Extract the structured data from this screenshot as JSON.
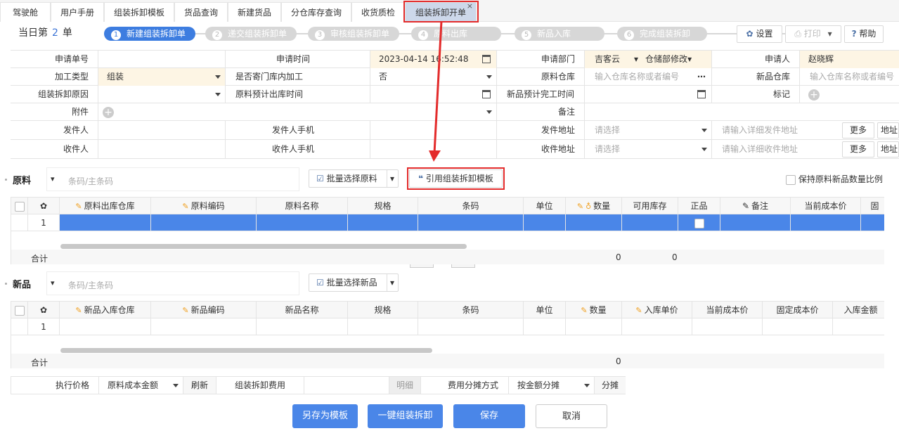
{
  "tabs": [
    "驾驶舱",
    "用户手册",
    "组装拆卸模板",
    "货品查询",
    "新建货品",
    "分仓库存查询",
    "收货质检",
    "组装拆卸开单"
  ],
  "tab_close": "×",
  "daycount": {
    "prefix": "当日第",
    "count": "2",
    "suffix": "单"
  },
  "steps": [
    {
      "n": "1",
      "label": "新建组装拆卸单"
    },
    {
      "n": "2",
      "label": "递交组装拆卸单"
    },
    {
      "n": "3",
      "label": "审核组装拆卸单"
    },
    {
      "n": "4",
      "label": "原料出库"
    },
    {
      "n": "5",
      "label": "新品入库"
    },
    {
      "n": "6",
      "label": "完成组装拆卸"
    }
  ],
  "toolbar": {
    "settings": "设置",
    "print": "打印",
    "help": "帮助"
  },
  "form": {
    "order_no_label": "申请单号",
    "order_no": "",
    "apply_time_label": "申请时间",
    "apply_time": "2023-04-14 16:52:48",
    "dept_label": "申请部门",
    "dept": "吉客云",
    "dept2": "仓储部修改",
    "applicant_label": "申请人",
    "applicant": "赵晓辉",
    "proc_type_label": "加工类型",
    "proc_type": "组装",
    "consign_label": "是否寄门库内加工",
    "consign": "否",
    "raw_wh_label": "原料仓库",
    "raw_wh_ph": "输入仓库名称或者编号",
    "new_wh_label": "新品仓库",
    "new_wh_ph": "输入仓库名称或者编号",
    "reason_label": "组装拆卸原因",
    "out_time_label": "原料预计出库时间",
    "finish_time_label": "新品预计完工时间",
    "tag_label": "标记",
    "attach_label": "附件",
    "remark_label": "备注",
    "sender_label": "发件人",
    "sender_phone_label": "发件人手机",
    "send_addr_label": "发件地址",
    "send_addr_ph": "请选择",
    "send_detail_ph": "请输入详细发件地址",
    "receiver_label": "收件人",
    "receiver_phone_label": "收件人手机",
    "recv_addr_label": "收件地址",
    "recv_addr_ph": "请选择",
    "recv_detail_ph": "请输入详细收件地址",
    "more": "更多",
    "addr_btn": "地址"
  },
  "raw": {
    "title": "原料",
    "search_ph": "条码/主条码",
    "batch_btn": "批量选择原料",
    "template_btn": "引用组装拆卸模板",
    "keep_ratio": "保持原料新品数量比例",
    "columns": [
      "原料出库仓库",
      "原料编码",
      "原料名称",
      "规格",
      "条码",
      "单位",
      "数量",
      "可用库存",
      "正品",
      "备注",
      "当前成本价",
      "固"
    ],
    "row_no": "1",
    "total_label": "合计",
    "total_qty": "0",
    "total_stock": "0"
  },
  "newp": {
    "title": "新品",
    "search_ph": "条码/主条码",
    "batch_btn": "批量选择新品",
    "columns": [
      "新品入库仓库",
      "新品编码",
      "新品名称",
      "规格",
      "条码",
      "单位",
      "数量",
      "入库单价",
      "当前成本价",
      "固定成本价",
      "入库金额"
    ],
    "row_no": "1",
    "total_label": "合计",
    "total_qty": "0"
  },
  "footer": {
    "exec_price_label": "执行价格",
    "exec_price": "原料成本金额",
    "refresh": "刷新",
    "fee_label": "组装拆卸费用",
    "detail": "明细",
    "alloc_label": "费用分摊方式",
    "alloc": "按金额分摊",
    "alloc_btn": "分摊"
  },
  "actions": {
    "save_template": "另存为模板",
    "one_key": "一键组装拆卸",
    "save": "保存",
    "cancel": "取消"
  },
  "colors": {
    "accent": "#4a86e8",
    "highlight_red": "#e32b2b",
    "selected_row": "#4a86e8"
  }
}
